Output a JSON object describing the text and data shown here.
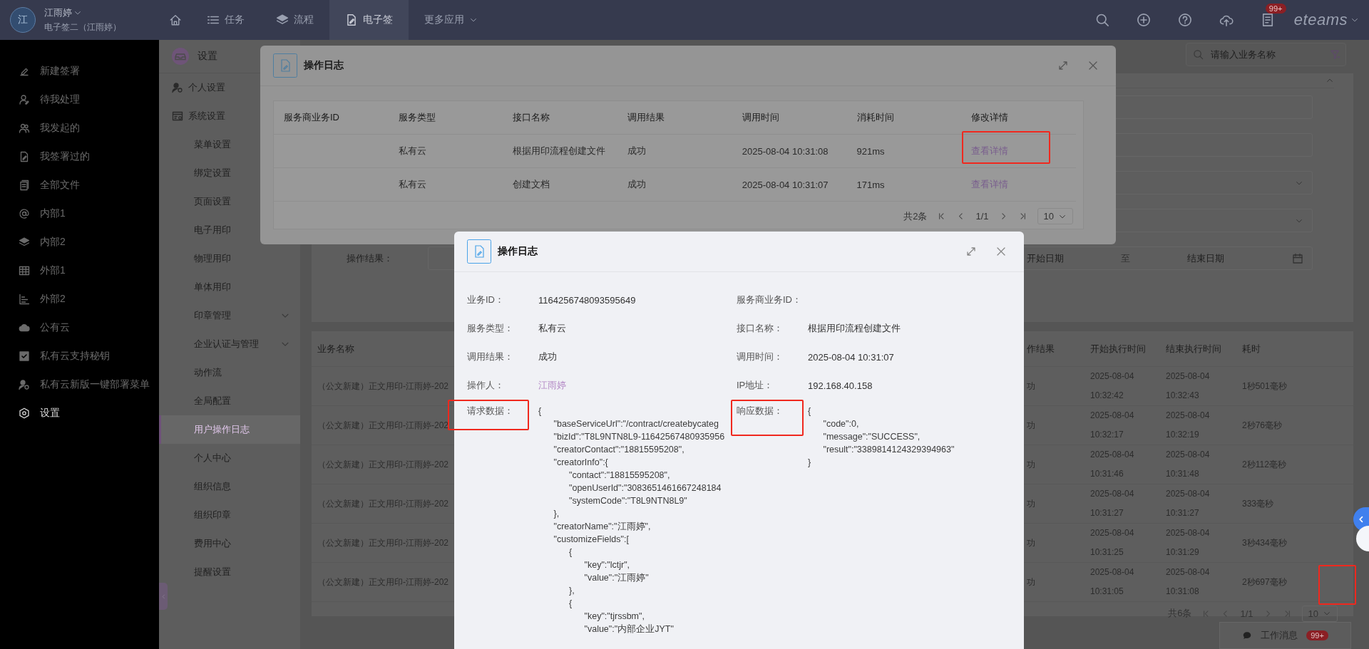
{
  "topbar": {
    "avatar": "江",
    "user_name": "江雨婷",
    "org": "电子签二（江雨婷）",
    "nav": [
      {
        "label": "任务",
        "kind": "link",
        "selected": false
      },
      {
        "label": "流程",
        "kind": "link",
        "selected": false
      },
      {
        "label": "电子签",
        "kind": "link",
        "selected": true
      },
      {
        "label": "更多应用",
        "kind": "menu",
        "selected": false
      }
    ],
    "notification_badge": "99+",
    "logo": "eteams"
  },
  "sidebar": {
    "items": [
      {
        "label": "新建签署",
        "selected": false
      },
      {
        "label": "待我处理",
        "selected": false
      },
      {
        "label": "我发起的",
        "selected": false
      },
      {
        "label": "我签署过的",
        "selected": false
      },
      {
        "label": "全部文件",
        "selected": false
      },
      {
        "label": "内部1",
        "selected": false
      },
      {
        "label": "内部2",
        "selected": false
      },
      {
        "label": "外部1",
        "selected": false
      },
      {
        "label": "外部2",
        "selected": false
      },
      {
        "label": "公有云",
        "selected": false
      },
      {
        "label": "私有云支持秘钥",
        "selected": false
      },
      {
        "label": "私有云新版一键部署菜单",
        "selected": false
      },
      {
        "label": "设置",
        "selected": true
      }
    ]
  },
  "submenu": {
    "title": "设置",
    "items": [
      {
        "label": "个人设置",
        "kind": "section",
        "selected": false
      },
      {
        "label": "系统设置",
        "kind": "section",
        "selected": false
      },
      {
        "label": "菜单设置",
        "kind": "item",
        "selected": false
      },
      {
        "label": "绑定设置",
        "kind": "item",
        "selected": false
      },
      {
        "label": "页面设置",
        "kind": "item",
        "selected": false
      },
      {
        "label": "电子用印",
        "kind": "item",
        "selected": false
      },
      {
        "label": "物理用印",
        "kind": "item",
        "selected": false
      },
      {
        "label": "单体用印",
        "kind": "item",
        "selected": false
      },
      {
        "label": "印章管理",
        "kind": "group",
        "expanded": false,
        "selected": false
      },
      {
        "label": "企业认证与管理",
        "kind": "group",
        "expanded": false,
        "selected": false
      },
      {
        "label": "动作流",
        "kind": "item",
        "selected": false
      },
      {
        "label": "全局配置",
        "kind": "item",
        "selected": false
      },
      {
        "label": "用户操作日志",
        "kind": "item",
        "selected": true
      },
      {
        "label": "个人中心",
        "kind": "item",
        "selected": false
      },
      {
        "label": "组织信息",
        "kind": "item",
        "selected": false
      },
      {
        "label": "组织印章",
        "kind": "item",
        "selected": false
      },
      {
        "label": "费用中心",
        "kind": "item",
        "selected": false
      },
      {
        "label": "提醒设置",
        "kind": "item",
        "selected": false
      }
    ]
  },
  "page": {
    "search": {
      "placeholder": "请输入业务名称"
    },
    "filter_fields": [
      {
        "kind": "input"
      },
      {
        "kind": "input"
      },
      {
        "kind": "select"
      },
      {
        "kind": "select"
      },
      {
        "kind": "date_range",
        "label": "操作结果：",
        "start_placeholder": "开始日期",
        "separator": "至",
        "end_placeholder": "结束日期"
      }
    ],
    "table": {
      "columns": [
        "业务名称",
        "作结果",
        "开始执行时间",
        "结束执行时间",
        "耗时"
      ],
      "rows": [
        {
          "name": "（公文新建）正文用印-江雨婷-202",
          "result": "功",
          "start_date": "2025-08-04",
          "start_time": "10:32:42",
          "end_date": "2025-08-04",
          "end_time": "10:32:43",
          "duration": "1秒501毫秒"
        },
        {
          "name": "（公文新建）正文用印-江雨婷-202",
          "result": "功",
          "start_date": "2025-08-04",
          "start_time": "10:32:17",
          "end_date": "2025-08-04",
          "end_time": "10:32:19",
          "duration": "2秒76毫秒"
        },
        {
          "name": "（公文新建）正文用印-江雨婷-202",
          "result": "功",
          "start_date": "2025-08-04",
          "start_time": "10:31:46",
          "end_date": "2025-08-04",
          "end_time": "10:31:48",
          "duration": "2秒112毫秒"
        },
        {
          "name": "（公文新建）正文用印-江雨婷-202",
          "result": "功",
          "start_date": "2025-08-04",
          "start_time": "10:31:27",
          "end_date": "2025-08-04",
          "end_time": "10:31:27",
          "duration": "333毫秒"
        },
        {
          "name": "（公文新建）正文用印-江雨婷-202",
          "result": "功",
          "start_date": "2025-08-04",
          "start_time": "10:31:25",
          "end_date": "2025-08-04",
          "end_time": "10:31:29",
          "duration": "3秒434毫秒"
        },
        {
          "name": "（公文新建）正文用印-江雨婷-202",
          "result": "功",
          "start_date": "2025-08-04",
          "start_time": "10:31:05",
          "end_date": "2025-08-04",
          "end_time": "10:31:08",
          "duration": "2秒697毫秒"
        }
      ],
      "pagination": {
        "total": "共6条",
        "page": "1/1",
        "size": "10"
      }
    }
  },
  "log_modal": {
    "title": "操作日志",
    "columns": [
      "服务商业务ID",
      "服务类型",
      "接口名称",
      "调用结果",
      "调用时间",
      "消耗时间",
      "修改详情"
    ],
    "rows": [
      {
        "service_type": "私有云",
        "api_name": "根据用印流程创建文件",
        "result": "成功",
        "time": "2025-08-04 10:31:08",
        "cost": "921ms",
        "link": "查看详情"
      },
      {
        "service_type": "私有云",
        "api_name": "创建文档",
        "result": "成功",
        "time": "2025-08-04 10:31:07",
        "cost": "171ms",
        "link": "查看详情"
      }
    ],
    "pagination": {
      "total": "共2条",
      "page": "1/1",
      "size": "10"
    }
  },
  "detail_modal": {
    "title": "操作日志",
    "fields": [
      {
        "label": "业务ID：",
        "value": "1164256748093595649",
        "kind": "text"
      },
      {
        "label": "服务商业务ID："
      },
      {
        "label": "服务类型：",
        "value": "私有云",
        "kind": "text"
      },
      {
        "label": "接口名称：",
        "value": "根据用印流程创建文件",
        "kind": "text"
      },
      {
        "label": "调用结果：",
        "value": "成功",
        "kind": "text"
      },
      {
        "label": "调用时间：",
        "value": "2025-08-04 10:31:07",
        "kind": "text"
      },
      {
        "label": "操作人：",
        "value": "江雨婷",
        "kind": "link"
      },
      {
        "label": "IP地址：",
        "value": "192.168.40.158",
        "kind": "text"
      }
    ],
    "request": {
      "label": "请求数据：",
      "lines": [
        {
          "text": "{",
          "children": [
            {
              "text": "\"baseServiceUrl\":\"/contract/createbycateg"
            },
            {
              "text": "\"bizId\":\"T8L9NTN8L9-11642567480935956"
            },
            {
              "text": "\"creatorContact\":\"18815595208\","
            },
            {
              "text": "\"creatorInfo\":{",
              "children": [
                {
                  "text": "\"contact\":\"18815595208\","
                },
                {
                  "text": "\"openUserId\":\"3083651461667248184"
                },
                {
                  "text": "\"systemCode\":\"T8L9NTN8L9\""
                }
              ]
            },
            {
              "text": "},"
            },
            {
              "text": "\"creatorName\":\"江雨婷\","
            },
            {
              "text": "\"customizeFields\":[",
              "children": [
                {
                  "text": "{",
                  "children": [
                    {
                      "text": "\"key\":\"lctjr\","
                    },
                    {
                      "text": "\"value\":\"江雨婷\""
                    }
                  ]
                },
                {
                  "text": "},"
                },
                {
                  "text": "{",
                  "children": [
                    {
                      "text": "\"key\":\"tjrssbm\","
                    },
                    {
                      "text": "\"value\":\"内部企业JYT\""
                    }
                  ]
                }
              ]
            }
          ]
        }
      ]
    },
    "response": {
      "label": "响应数据：",
      "lines": [
        {
          "text": "{",
          "children": [
            {
              "text": "\"code\":0,"
            },
            {
              "text": "\"message\":\"SUCCESS\","
            },
            {
              "text": "\"result\":\"3389814124329394963\""
            }
          ]
        },
        {
          "text": "}"
        }
      ]
    }
  },
  "work_message": {
    "label": "工作消息",
    "badge": "99+"
  }
}
